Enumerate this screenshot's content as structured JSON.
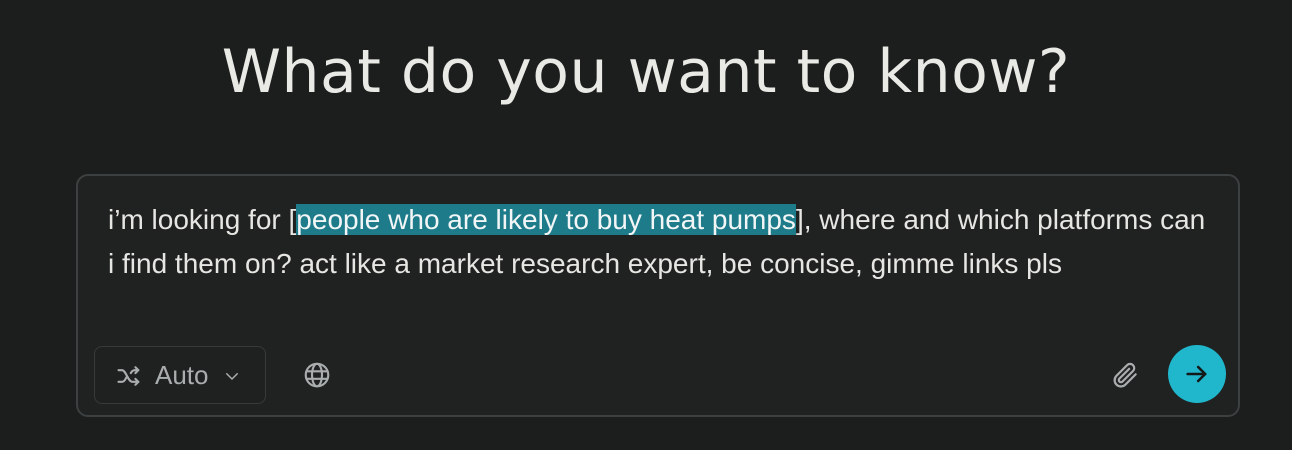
{
  "headline": "What do you want to know?",
  "query": {
    "before": "i’m looking for [",
    "highlighted": "people who are likely to buy heat pumps",
    "after": "], where and which platforms can i find them on? act like a market research expert, be concise, gimme links pls"
  },
  "toolbar": {
    "mode_label": "Auto",
    "mode_icon": "shuffle-icon",
    "mode_dropdown_icon": "chevron-down-icon",
    "search_icon": "globe-icon",
    "attach_icon": "paperclip-icon",
    "submit_icon": "arrow-right-icon"
  },
  "colors": {
    "background": "#1c1e1e",
    "composer_background": "#202222",
    "highlight": "#1e7b8a",
    "submit": "#20b6cc"
  }
}
